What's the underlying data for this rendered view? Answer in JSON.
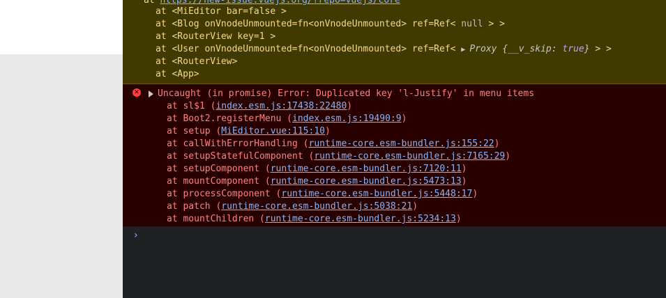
{
  "warning": {
    "top_link": "https://new-issue.vuejs.org/?repo=vuejs/core",
    "lines": [
      {
        "text": "at <MiEditor bar=false >"
      },
      {
        "text": "at <Blog onVnodeUnmounted=fn<onVnodeUnmounted> ref=Ref< ",
        "muted": "null",
        "after": " > >"
      },
      {
        "text": "at <RouterView key=1 >"
      },
      {
        "text": "at <User onVnodeUnmounted=fn<onVnodeUnmounted> ref=Ref< ",
        "proxy_label": "Proxy",
        "proxy_obj": " {__v_skip: ",
        "proxy_val": "true",
        "proxy_end": "}",
        "after": " > >"
      },
      {
        "text": "at <RouterView>"
      },
      {
        "text": "at <App>"
      }
    ]
  },
  "error": {
    "icon": "error-icon",
    "message": "Uncaught (in promise) Error: Duplicated key 'l-Justify' in menu items",
    "frames": [
      {
        "fn": "at sl$1 (",
        "link": "index.esm.js:17438:22480",
        "end": ")"
      },
      {
        "fn": "at Boot2.registerMenu (",
        "link": "index.esm.js:19490:9",
        "end": ")"
      },
      {
        "fn": "at setup (",
        "link": "MiEditor.vue:115:10",
        "end": ")"
      },
      {
        "fn": "at callWithErrorHandling (",
        "link": "runtime-core.esm-bundler.js:155:22",
        "end": ")"
      },
      {
        "fn": "at setupStatefulComponent (",
        "link": "runtime-core.esm-bundler.js:7165:29",
        "end": ")"
      },
      {
        "fn": "at setupComponent (",
        "link": "runtime-core.esm-bundler.js:7120:11",
        "end": ")"
      },
      {
        "fn": "at mountComponent (",
        "link": "runtime-core.esm-bundler.js:5473:13",
        "end": ")"
      },
      {
        "fn": "at processComponent (",
        "link": "runtime-core.esm-bundler.js:5448:17",
        "end": ")"
      },
      {
        "fn": "at patch (",
        "link": "runtime-core.esm-bundler.js:5038:21",
        "end": ")"
      },
      {
        "fn": "at mountChildren (",
        "link": "runtime-core.esm-bundler.js:5234:13",
        "end": ")"
      }
    ]
  },
  "prompt": {
    "symbol": "›"
  },
  "colors": {
    "warning_bg": "#413a00",
    "error_bg": "#290000",
    "error_text": "#ff8080",
    "link": "#8ab4f8",
    "console_bg": "#202124"
  }
}
